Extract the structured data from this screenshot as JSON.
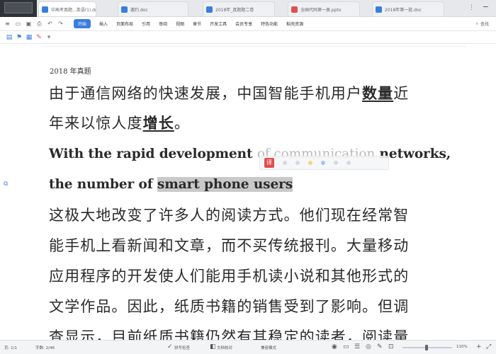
{
  "tabs": [
    {
      "label": "中高考真题...英语(1).doc",
      "icon_color": "#3b7ddd"
    },
    {
      "label": "邀约.doc",
      "icon_color": "#3b7ddd"
    },
    {
      "label": "2018年_真题题二卷",
      "icon_color": "#3b7ddd"
    },
    {
      "label": "全国代码第一册.pptx",
      "icon_color": "#e04f4f"
    },
    {
      "label": "2018年第一批.doc",
      "icon_color": "#3b7ddd"
    }
  ],
  "menu": {
    "items": [
      "开始",
      "插入",
      "页面布局",
      "引用",
      "审阅",
      "视图",
      "章节",
      "开发工具",
      "会员专享",
      "特色功能",
      "稻壳资源"
    ],
    "active_index": 0,
    "search_label": "查找"
  },
  "document": {
    "heading": "2018 年真题",
    "p1_line1": {
      "pre": "由于通信网络的快速发展，中国智能手机用户",
      "keyword": "数量",
      "post": "近"
    },
    "p1_line2": {
      "pre": "年来以惊人度",
      "keyword": "增长",
      "post": "。"
    },
    "en_line1": {
      "pre": "With the rapid development ",
      "ghost": "of communication",
      "post": " networks,"
    },
    "en_line2": {
      "pre": "the number of ",
      "selected": "smart phone users"
    },
    "p2_lines": [
      "这极大地改变了许多人的阅读方式。他们现在经常智",
      "能手机上看新闻和文章，而不买传统报刊。大量移动",
      "应用程序的开发使人们能用手机读小说和其他形式的",
      "文学作品。因此，纸质书籍的销售受到了影响。但调"
    ],
    "p2_cut_line": "查显示，目前纸质书籍仍然有其稳定的读者，阅读量"
  },
  "mini_toolbar": {
    "translate_label": "译"
  },
  "status": {
    "page": "页: 1/1",
    "words": "字数: 2/46",
    "spell": "拼写检查",
    "doc_check": "文档校对",
    "compat": "兼容模式",
    "zoom": "110%"
  }
}
